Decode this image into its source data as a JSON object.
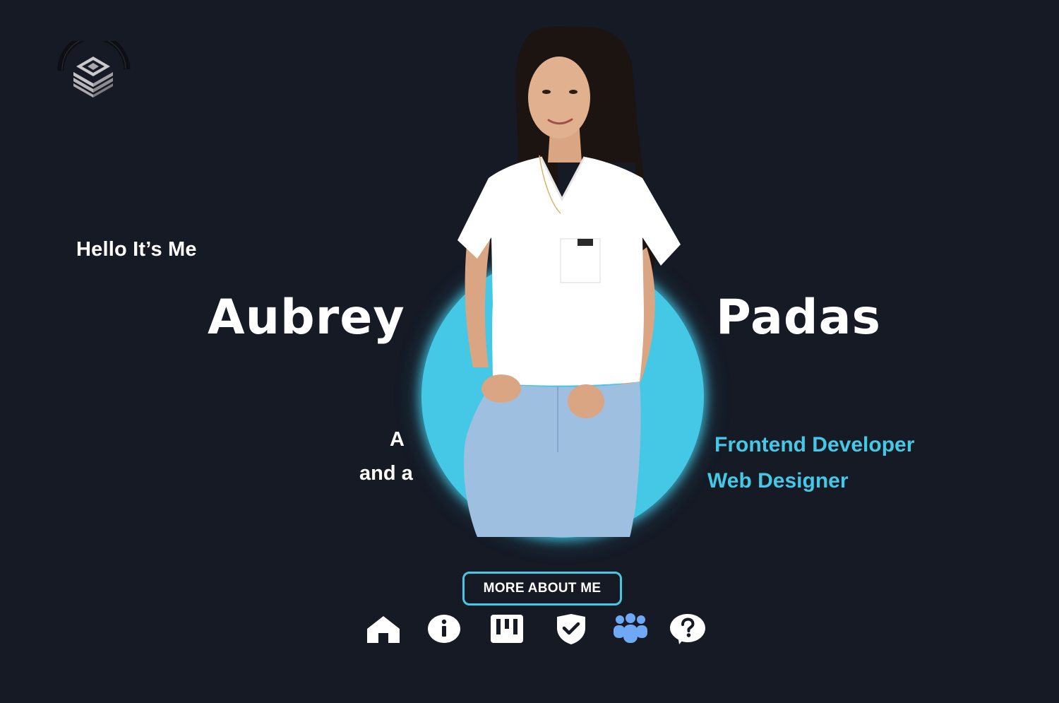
{
  "hero": {
    "greeting": "Hello It’s Me",
    "first_name": "Aubrey",
    "last_name": "Padas",
    "prefix_1": "A",
    "prefix_2": "and a",
    "role_1": "Frontend Developer",
    "role_2": "Web Designer"
  },
  "cta": {
    "label": "MORE ABOUT ME"
  },
  "nav": {
    "items": [
      {
        "icon": "home-icon"
      },
      {
        "icon": "info-icon"
      },
      {
        "icon": "projects-icon"
      },
      {
        "icon": "shield-check-icon"
      },
      {
        "icon": "team-icon",
        "active": true
      },
      {
        "icon": "help-icon"
      }
    ]
  },
  "colors": {
    "background": "#151a25",
    "accent": "#45c8e5",
    "text": "#ffffff",
    "active_nav": "#6fa8f4"
  }
}
